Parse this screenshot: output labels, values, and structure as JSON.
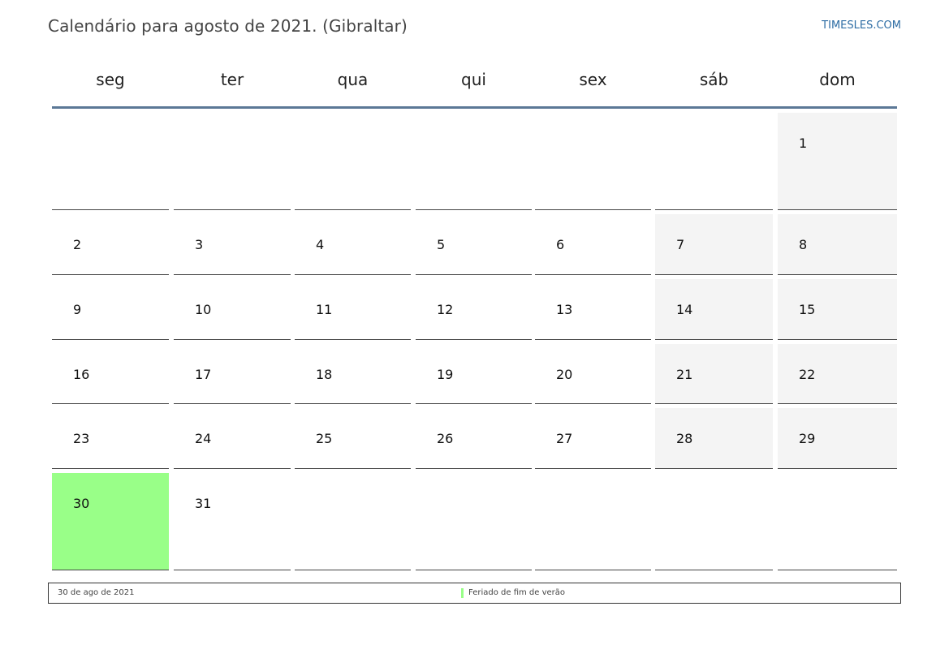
{
  "header": {
    "title": "Calendário para agosto de 2021. (Gibraltar)",
    "site": "TIMESLES.COM"
  },
  "calendar": {
    "weekdays": [
      "seg",
      "ter",
      "qua",
      "qui",
      "sex",
      "sáb",
      "dom"
    ],
    "weeks": [
      [
        "",
        "",
        "",
        "",
        "",
        "",
        "1"
      ],
      [
        "2",
        "3",
        "4",
        "5",
        "6",
        "7",
        "8"
      ],
      [
        "9",
        "10",
        "11",
        "12",
        "13",
        "14",
        "15"
      ],
      [
        "16",
        "17",
        "18",
        "19",
        "20",
        "21",
        "22"
      ],
      [
        "23",
        "24",
        "25",
        "26",
        "27",
        "28",
        "29"
      ],
      [
        "30",
        "31",
        "",
        "",
        "",
        "",
        ""
      ]
    ],
    "holidays": [
      "30"
    ]
  },
  "footer": {
    "date": "30 de ago de 2021",
    "holiday_name": "Feriado de fim de verão"
  },
  "colors": {
    "holiday": "#99ff88",
    "weekend": "#f4f4f4",
    "header_rule": "#5b7896",
    "site_link": "#2e6da4"
  }
}
